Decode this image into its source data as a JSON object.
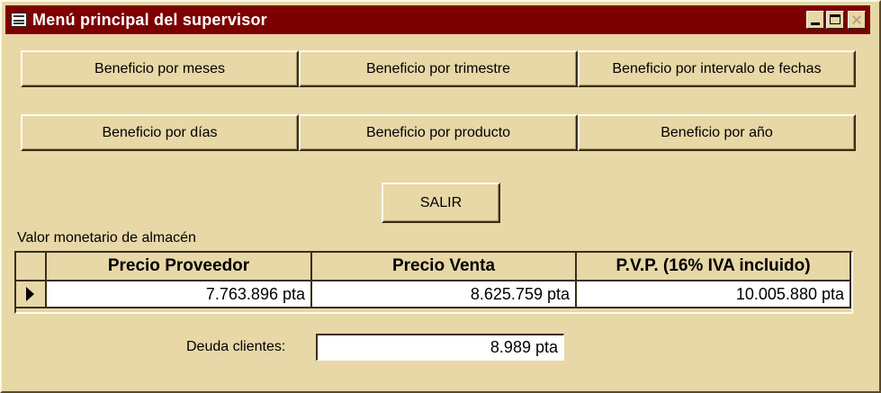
{
  "window": {
    "title": "Menú principal del supervisor"
  },
  "buttons": {
    "meses": "Beneficio por meses",
    "trimestre": "Beneficio por trimestre",
    "intervalo": "Beneficio por intervalo de fechas",
    "dias": "Beneficio por días",
    "producto": "Beneficio por producto",
    "anio": "Beneficio por año",
    "salir": "SALIR"
  },
  "almacen": {
    "caption": "Valor monetario de almacén",
    "columns": [
      "Precio Proveedor",
      "Precio Venta",
      "P.V.P. (16% IVA incluido)"
    ],
    "row": [
      "7.763.896 pta",
      "8.625.759 pta",
      "10.005.880 pta"
    ]
  },
  "deuda": {
    "label": "Deuda clientes:",
    "value": "8.989 pta"
  },
  "colors": {
    "titlebar": "#7d0000",
    "face": "#e8d7a7"
  }
}
